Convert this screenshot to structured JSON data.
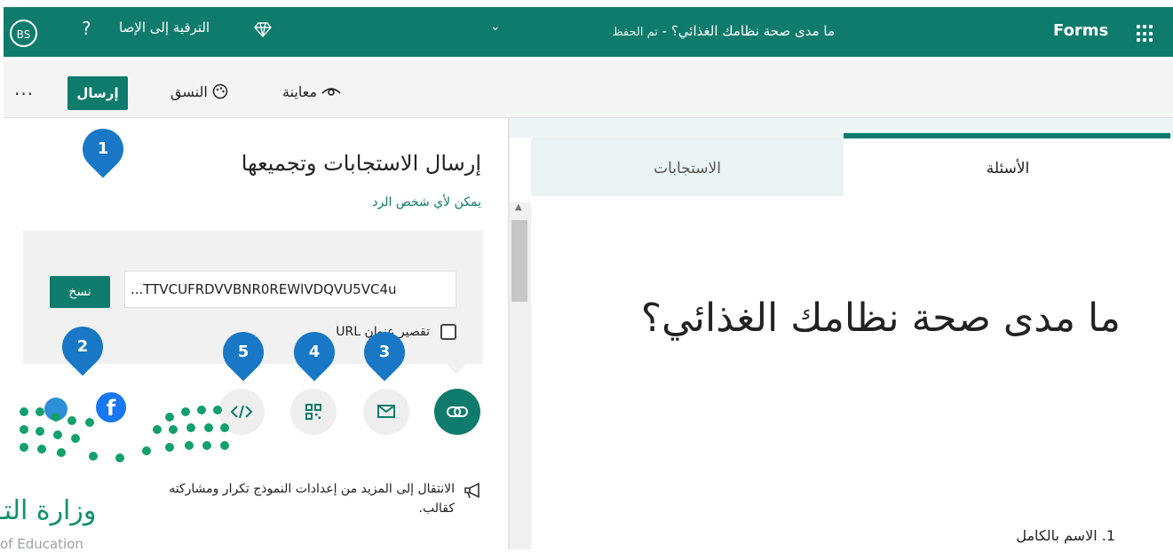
{
  "header": {
    "app_name": "Forms",
    "doc_title": "ما مدى صحة نظامك الغذائي؟",
    "save_status": "تم الحفظ",
    "title_separator": " - ",
    "upgrade_label": "الترقية إلى الإصا",
    "help_label": "?",
    "avatar_initials": "BS"
  },
  "toolbar": {
    "send_label": "إرسال",
    "theme_label": "النسق",
    "preview_label": "معاينة",
    "more_label": "..."
  },
  "send_panel": {
    "title": "إرسال الاستجابات وتجميعها",
    "subtitle": "يمكن لأي شخص الرد",
    "url_value": "...TTVCUFRDVVBNR0REWlVDQVU5VC4u",
    "copy_label": "نسخ",
    "shorten_label": "تقصير عنوان URL",
    "shorten_checked": false,
    "share_options": [
      "link-icon",
      "mail-icon",
      "qr-code-icon",
      "embed-icon",
      "facebook-icon",
      "twitter-icon"
    ],
    "tip_text": "الانتقال إلى المزيد من إعدادات النموذج تكرار ومشاركته كقالب."
  },
  "markers": [
    "1",
    "2",
    "3",
    "4",
    "5"
  ],
  "tabs": {
    "questions_label": "الأسئلة",
    "responses_label": "الاستجابات",
    "active": "questions"
  },
  "form": {
    "title": "ما مدى صحة نظامك الغذائي؟",
    "question_1": "1. الاسم بالكامل"
  },
  "watermark": {
    "text": "وزارة التـ",
    "subtext": "of Education"
  },
  "colors": {
    "brand_teal": "#0f7b6c",
    "marker_blue": "#1878c5",
    "facebook_blue": "#1877f2"
  }
}
